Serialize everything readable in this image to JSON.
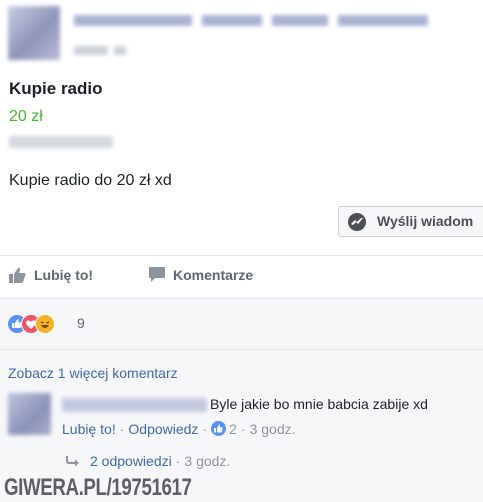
{
  "post": {
    "title": "Kupie radio",
    "price": "20 zł",
    "description": "Kupie radio do 20 zł xd",
    "message_button": "Wyślij wiadom"
  },
  "actions": {
    "like": "Lubię to!",
    "comment": "Komentarze"
  },
  "reactions": {
    "icons": [
      "like-reaction",
      "love-reaction",
      "haha-reaction"
    ],
    "count": "9"
  },
  "comments": {
    "view_more": "Zobacz 1 więcej komentarz",
    "items": [
      {
        "text": "Byle jakie bo mnie babcia zabije xd",
        "like_label": "Lubię to!",
        "reply_label": "Odpowiedz",
        "like_count": "2",
        "time": "3 godz.",
        "replies_label": "2 odpowiedzi",
        "replies_time": "3 godz."
      }
    ]
  },
  "watermark": "GIWERA.PL/19751617",
  "colors": {
    "price": "#42b72a",
    "link": "#4267b2",
    "muted": "#90949c",
    "like_blue": "#5890ff",
    "love_red": "#f25268",
    "haha_yellow": "#f7b125"
  }
}
